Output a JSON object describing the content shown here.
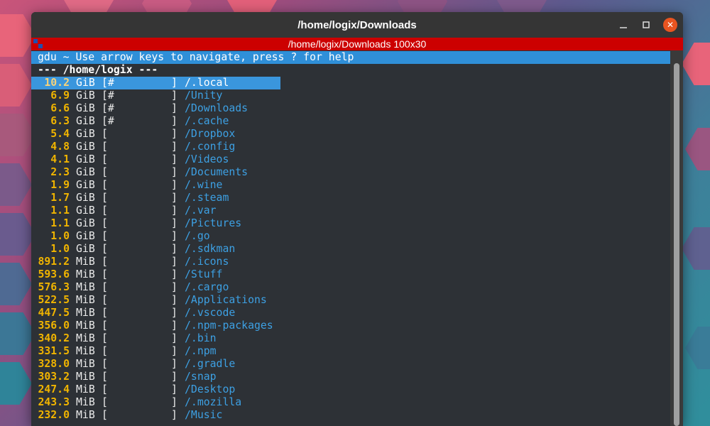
{
  "window": {
    "title": "/home/logix/Downloads",
    "tab_title": "/home/logix/Downloads  100x30",
    "minimize_icon": "minimize-icon",
    "maximize_icon": "maximize-icon",
    "close_icon": "close-icon",
    "close_symbol": "✕"
  },
  "terminal": {
    "help_text": "gdu ~ Use arrow keys to navigate, press ? for help",
    "path_text": "--- /home/logix ---",
    "selected_index": 0,
    "rows": [
      {
        "size": "10.2",
        "unit": "GiB",
        "bar": "[#         ]",
        "name": "/.local"
      },
      {
        "size": "6.9",
        "unit": "GiB",
        "bar": "[#         ]",
        "name": "/Unity"
      },
      {
        "size": "6.6",
        "unit": "GiB",
        "bar": "[#         ]",
        "name": "/Downloads"
      },
      {
        "size": "6.3",
        "unit": "GiB",
        "bar": "[#         ]",
        "name": "/.cache"
      },
      {
        "size": "5.4",
        "unit": "GiB",
        "bar": "[          ]",
        "name": "/Dropbox"
      },
      {
        "size": "4.8",
        "unit": "GiB",
        "bar": "[          ]",
        "name": "/.config"
      },
      {
        "size": "4.1",
        "unit": "GiB",
        "bar": "[          ]",
        "name": "/Videos"
      },
      {
        "size": "2.3",
        "unit": "GiB",
        "bar": "[          ]",
        "name": "/Documents"
      },
      {
        "size": "1.9",
        "unit": "GiB",
        "bar": "[          ]",
        "name": "/.wine"
      },
      {
        "size": "1.7",
        "unit": "GiB",
        "bar": "[          ]",
        "name": "/.steam"
      },
      {
        "size": "1.1",
        "unit": "GiB",
        "bar": "[          ]",
        "name": "/.var"
      },
      {
        "size": "1.1",
        "unit": "GiB",
        "bar": "[          ]",
        "name": "/Pictures"
      },
      {
        "size": "1.0",
        "unit": "GiB",
        "bar": "[          ]",
        "name": "/.go"
      },
      {
        "size": "1.0",
        "unit": "GiB",
        "bar": "[          ]",
        "name": "/.sdkman"
      },
      {
        "size": "891.2",
        "unit": "MiB",
        "bar": "[          ]",
        "name": "/.icons"
      },
      {
        "size": "593.6",
        "unit": "MiB",
        "bar": "[          ]",
        "name": "/Stuff"
      },
      {
        "size": "576.3",
        "unit": "MiB",
        "bar": "[          ]",
        "name": "/.cargo"
      },
      {
        "size": "522.5",
        "unit": "MiB",
        "bar": "[          ]",
        "name": "/Applications"
      },
      {
        "size": "447.5",
        "unit": "MiB",
        "bar": "[          ]",
        "name": "/.vscode"
      },
      {
        "size": "356.0",
        "unit": "MiB",
        "bar": "[          ]",
        "name": "/.npm-packages"
      },
      {
        "size": "340.2",
        "unit": "MiB",
        "bar": "[          ]",
        "name": "/.bin"
      },
      {
        "size": "331.5",
        "unit": "MiB",
        "bar": "[          ]",
        "name": "/.npm"
      },
      {
        "size": "328.0",
        "unit": "MiB",
        "bar": "[          ]",
        "name": "/.gradle"
      },
      {
        "size": "303.2",
        "unit": "MiB",
        "bar": "[          ]",
        "name": "/snap"
      },
      {
        "size": "247.4",
        "unit": "MiB",
        "bar": "[          ]",
        "name": "/Desktop"
      },
      {
        "size": "243.3",
        "unit": "MiB",
        "bar": "[          ]",
        "name": "/.mozilla"
      },
      {
        "size": "232.0",
        "unit": "MiB",
        "bar": "[          ]",
        "name": "/Music"
      }
    ]
  },
  "colors": {
    "size_text": "#f0b400",
    "name_text": "#3da0e3",
    "help_bar": "#2f8fd8",
    "selection": "#3a96dd",
    "tab_bar": "#cc0000",
    "terminal_bg": "#2d3136"
  }
}
